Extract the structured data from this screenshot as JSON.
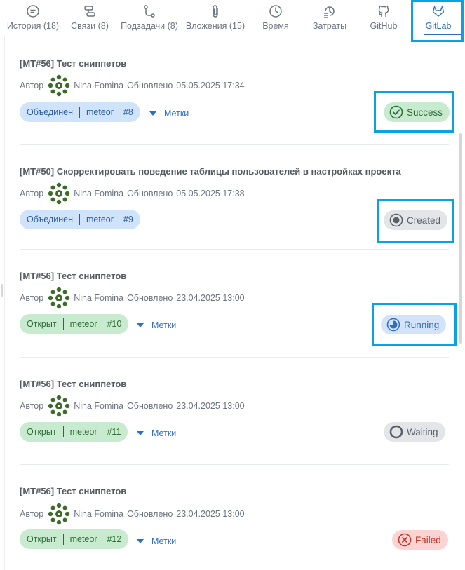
{
  "tabs": [
    {
      "label": "История (18)",
      "icon": "history-icon"
    },
    {
      "label": "Связи (8)",
      "icon": "links-icon"
    },
    {
      "label": "Подзадачи (8)",
      "icon": "subtasks-icon"
    },
    {
      "label": "Вложения (15)",
      "icon": "paperclip-icon"
    },
    {
      "label": "Время",
      "icon": "clock-icon"
    },
    {
      "label": "Затраты",
      "icon": "costs-icon"
    },
    {
      "label": "GitHub",
      "icon": "github-icon"
    },
    {
      "label": "GitLab",
      "icon": "gitlab-icon",
      "active": true
    }
  ],
  "common": {
    "author_label": "Автор",
    "author_name": "Nina Fomina",
    "updated_label": "Обновлено",
    "labels_link": "Метки"
  },
  "items": [
    {
      "title": "[MT#56] Тест сниппетов",
      "updated": "05.05.2025 17:34",
      "state": "Объединен",
      "branch": "meteor",
      "number": "#8",
      "show_labels": true,
      "status": "Success"
    },
    {
      "title": "[MT#50] Скорректировать поведение таблицы пользователей в настройках проекта",
      "updated": "05.05.2025 17:38",
      "state": "Объединен",
      "branch": "meteor",
      "number": "#9",
      "show_labels": false,
      "status": "Created"
    },
    {
      "title": "[MT#56] Тест сниппетов",
      "updated": "23.04.2025 13:00",
      "state": "Открыт",
      "branch": "meteor",
      "number": "#10",
      "show_labels": true,
      "status": "Running"
    },
    {
      "title": "[MT#56] Тест сниппетов",
      "updated": "23.04.2025 13:00",
      "state": "Открыт",
      "branch": "meteor",
      "number": "#11",
      "show_labels": true,
      "status": "Waiting"
    },
    {
      "title": "[MT#56] Тест сниппетов",
      "updated": "23.04.2025 13:00",
      "state": "Открыт",
      "branch": "meteor",
      "number": "#12",
      "show_labels": true,
      "status": "Failed"
    }
  ],
  "colors": {
    "accent": "#2f6fbf",
    "highlight": "#0aa2e0",
    "success": "#2d6b39",
    "failed": "#c0392b"
  }
}
